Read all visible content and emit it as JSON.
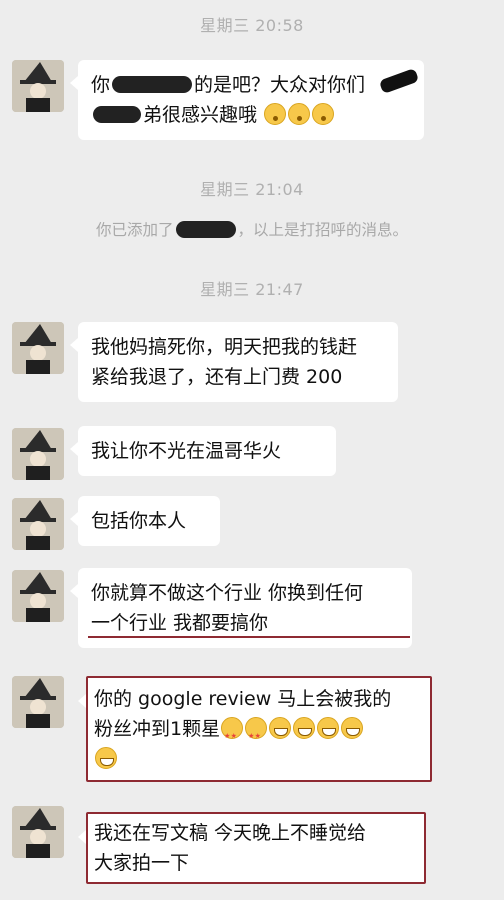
{
  "timestamps": {
    "t1": "星期三 20:58",
    "t2": "星期三 21:04",
    "t3": "星期三 21:47"
  },
  "system": {
    "pre": "你已添加了",
    "post": "，以上是打招呼的消息。"
  },
  "messages": {
    "m1": {
      "a": "你",
      "b": "的是吧？大众对你们",
      "c": "弟很感兴趣哦"
    },
    "m2": {
      "line1": "我他妈搞死你，明天把我的钱赶",
      "line2": "紧给我退了，还有上门费 200"
    },
    "m3": {
      "text": "我让你不光在温哥华火"
    },
    "m4": {
      "text": "包括你本人"
    },
    "m5": {
      "line1": "你就算不做这个行业 你换到任何",
      "line2": "一个行业 我都要搞你"
    },
    "m6": {
      "line1": "你的 google review 马上会被我的",
      "line2": "粉丝冲到1颗星"
    },
    "m7": {
      "line1": "我还在写文稿 今天晚上不睡觉给",
      "line2": "大家拍一下"
    }
  },
  "icons": {
    "avatar": "witch-hat-avatar-icon",
    "emoji_grin": "grinning-face-icon",
    "emoji_star": "star-struck-face-icon",
    "emoji_hush": "shushing-face-icon"
  },
  "colors": {
    "background": "#ededed",
    "bubble": "#ffffff",
    "annotation": "#8e2a32"
  }
}
